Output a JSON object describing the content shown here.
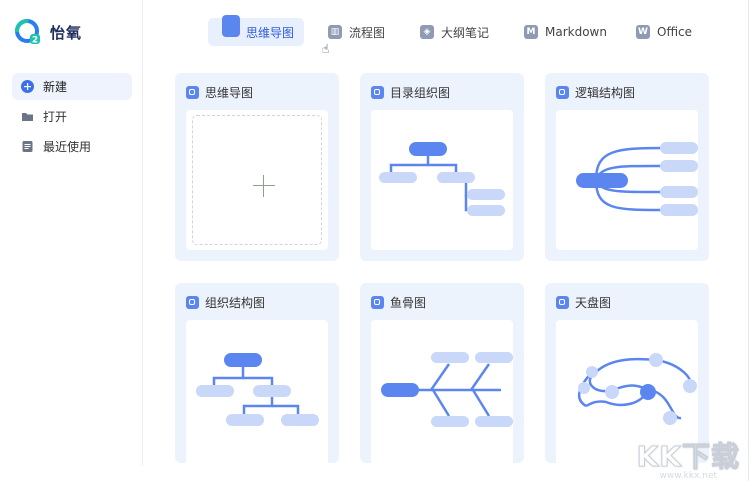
{
  "app": {
    "logo_text": "怡氧"
  },
  "sidebar": {
    "items": [
      {
        "label": "新建",
        "icon": "plus-circle-icon",
        "active": true
      },
      {
        "label": "打开",
        "icon": "folder-icon",
        "active": false
      },
      {
        "label": "最近使用",
        "icon": "document-icon",
        "active": false
      }
    ]
  },
  "tabs": [
    {
      "label": "思维导图",
      "icon": "mindmap-icon",
      "active": true
    },
    {
      "label": "流程图",
      "icon": "flowchart-icon",
      "active": false
    },
    {
      "label": "大纲笔记",
      "icon": "outline-icon",
      "active": false
    },
    {
      "label": "Markdown",
      "icon": "markdown-icon",
      "icon_text": "M",
      "active": false
    },
    {
      "label": "Office",
      "icon": "office-icon",
      "icon_text": "W",
      "active": false
    }
  ],
  "templates": [
    {
      "title": "思维导图",
      "preview": "blank"
    },
    {
      "title": "目录组织图",
      "preview": "directory"
    },
    {
      "title": "逻辑结构图",
      "preview": "logic"
    },
    {
      "title": "组织结构图",
      "preview": "org"
    },
    {
      "title": "鱼骨图",
      "preview": "fishbone"
    },
    {
      "title": "天盘图",
      "preview": "orbit"
    }
  ],
  "watermark": {
    "logo": "KK下载",
    "url": "www.kkx.net"
  },
  "colors": {
    "accent": "#5b86f0",
    "node_dark": "#5b86f0",
    "node_light": "#c9d8f8",
    "card_bg": "#edf3fd",
    "logo_text": "#1f2d5a"
  }
}
